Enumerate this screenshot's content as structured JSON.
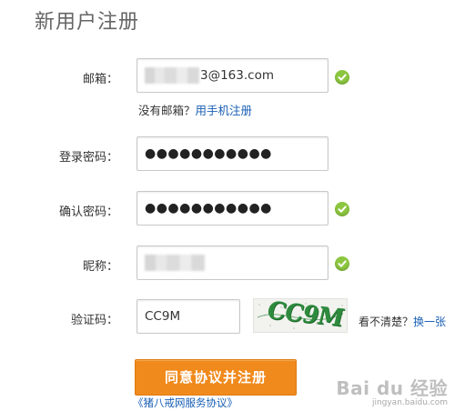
{
  "page": {
    "title": "新用户注册"
  },
  "form": {
    "email": {
      "label": "邮箱：",
      "value": "3@163.com",
      "valid": true
    },
    "email_hint": {
      "text": "没有邮箱？",
      "link": "用手机注册"
    },
    "password": {
      "label": "登录密码：",
      "value": "●●●●●●●●●●●",
      "valid": false
    },
    "confirm": {
      "label": "确认密码：",
      "value": "●●●●●●●●●●●",
      "valid": true
    },
    "nickname": {
      "label": "昵称：",
      "value": "",
      "valid": true
    },
    "captcha": {
      "label": "验证码：",
      "value": "CC9M",
      "image_text": "CC9M",
      "refresh_hint": "看不清楚？",
      "refresh_link": "换一张"
    }
  },
  "submit": {
    "label": "同意协议并注册"
  },
  "agreement": {
    "label": "《猪八戒网服务协议》"
  },
  "watermark": {
    "logo": "Bai du 经验",
    "sub": "jingyan.baidu.com"
  },
  "colors": {
    "accent": "#f08a1c",
    "link": "#1a5fb4",
    "valid": "#8cc63f",
    "captcha": "#2e8b3e"
  }
}
